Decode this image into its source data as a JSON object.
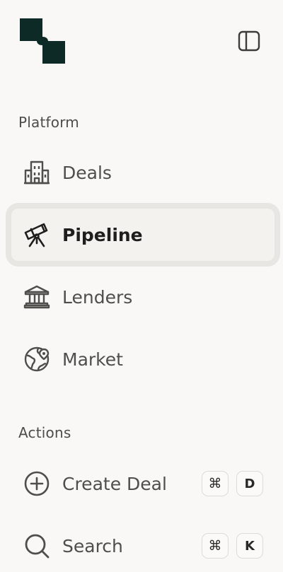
{
  "sidebar": {
    "brand": {
      "logo_color": "#0d2a26"
    },
    "toggle_icon": "sidebar-panel-icon",
    "sections": {
      "platform": {
        "label": "Platform",
        "items": [
          {
            "label": "Deals",
            "icon": "building-icon",
            "active": false
          },
          {
            "label": "Pipeline",
            "icon": "telescope-icon",
            "active": true
          },
          {
            "label": "Lenders",
            "icon": "bank-icon",
            "active": false
          },
          {
            "label": "Market",
            "icon": "globe-icon",
            "active": false
          }
        ]
      },
      "actions": {
        "label": "Actions",
        "items": [
          {
            "label": "Create Deal",
            "icon": "plus-circle-icon",
            "shortcut": [
              "⌘",
              "D"
            ]
          },
          {
            "label": "Search",
            "icon": "search-icon",
            "shortcut": [
              "⌘",
              "K"
            ]
          }
        ]
      }
    }
  },
  "colors": {
    "background": "#f9f8f6",
    "active_bg": "#f3f2ef",
    "text": "#4f4e4b",
    "active_text": "#1f1e1c"
  }
}
